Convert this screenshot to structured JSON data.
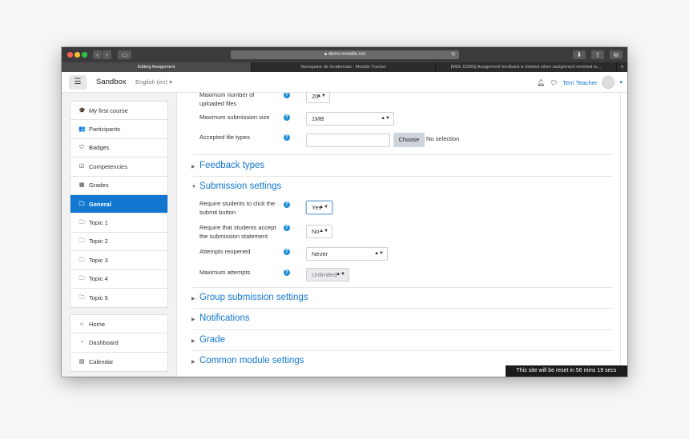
{
  "browser": {
    "url": "demo.moodle.net",
    "tabs": [
      {
        "label": "Editing Assignment",
        "active": true
      },
      {
        "label": "Navegador de Incidencias - Moodle Tracker",
        "active": false
      },
      {
        "label": "[MDL-53965] Assignment feedback is deleted when assignment reverted to...",
        "active": false
      }
    ],
    "new_tab": "+"
  },
  "navbar": {
    "menu_icon": "☰",
    "brand": "Sandbox",
    "language": "English (en) ▾",
    "notifications_icon": "bell-icon",
    "messages_icon": "chat-icon",
    "user_name": "Terri Teacher",
    "user_menu_caret": "▾"
  },
  "drawer": {
    "course_items": [
      {
        "label": "My first course",
        "icon": "graduation-cap-icon",
        "glyph": "🎓"
      },
      {
        "label": "Participants",
        "icon": "users-icon",
        "glyph": "👥"
      },
      {
        "label": "Badges",
        "icon": "shield-icon",
        "glyph": "⛉"
      },
      {
        "label": "Competencies",
        "icon": "check-square-icon",
        "glyph": "☑"
      },
      {
        "label": "Grades",
        "icon": "table-icon",
        "glyph": "▦"
      },
      {
        "label": "General",
        "icon": "folder-icon",
        "glyph": "🗀",
        "active": true
      },
      {
        "label": "Topic 1",
        "icon": "folder-icon",
        "glyph": "🗀"
      },
      {
        "label": "Topic 2",
        "icon": "folder-icon",
        "glyph": "🗀"
      },
      {
        "label": "Topic 3",
        "icon": "folder-icon",
        "glyph": "🗀"
      },
      {
        "label": "Topic 4",
        "icon": "folder-icon",
        "glyph": "🗀"
      },
      {
        "label": "Topic 5",
        "icon": "folder-icon",
        "glyph": "🗀"
      }
    ],
    "site_items": [
      {
        "label": "Home",
        "icon": "home-icon",
        "glyph": "⌂"
      },
      {
        "label": "Dashboard",
        "icon": "dashboard-icon",
        "glyph": "◔"
      },
      {
        "label": "Calendar",
        "icon": "calendar-icon",
        "glyph": "▤"
      }
    ]
  },
  "form": {
    "max_files": {
      "label": "Maximum number of uploaded files",
      "value": "20"
    },
    "max_size": {
      "label": "Maximum submission size",
      "value": "1MB"
    },
    "file_types": {
      "label": "Accepted file types",
      "button": "Choose",
      "note": "No selection"
    },
    "feedback_section": "Feedback types",
    "submission_section": "Submission settings",
    "require_submit": {
      "label": "Require students to click the submit button",
      "value": "Yes"
    },
    "require_statement": {
      "label": "Require that students accept the submission statement",
      "value": "No"
    },
    "attempts_reopened": {
      "label": "Attempts reopened",
      "value": "Never"
    },
    "max_attempts": {
      "label": "Maximum attempts",
      "value": "Unlimited"
    },
    "group_section": "Group submission settings",
    "notifications_section": "Notifications",
    "grade_section": "Grade",
    "common_section": "Common module settings",
    "help_glyph": "?"
  },
  "reset_notice": "This site will be reset in 56 mins 19 secs"
}
